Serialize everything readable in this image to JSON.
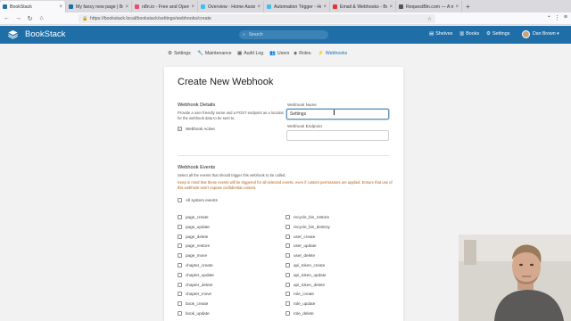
{
  "browser": {
    "tabs": [
      {
        "label": "BookStack",
        "active": true,
        "color": "#206ea7"
      },
      {
        "label": "My fancy new page | Bo",
        "active": false,
        "color": "#206ea7"
      },
      {
        "label": "n8n.io - Free and Open S",
        "active": false,
        "color": "#ea4b71"
      },
      {
        "label": "Overview - Home Assista",
        "active": false,
        "color": "#41bdf5"
      },
      {
        "label": "Automation Trigger - Hom",
        "active": false,
        "color": "#41bdf5"
      },
      {
        "label": "Email & Webhooks - Bots",
        "active": false,
        "color": "#e3342f"
      },
      {
        "label": "RequestBin.com — A mo",
        "active": false,
        "color": "#555555"
      }
    ],
    "new_tab": "+",
    "url": "https://bookstack.local/bookstack/settings/webhooks/create"
  },
  "header": {
    "app_name": "BookStack",
    "search_placeholder": "Search",
    "nav": [
      {
        "label": "Shelves",
        "icon": "shelves-icon"
      },
      {
        "label": "Books",
        "icon": "books-icon"
      },
      {
        "label": "Settings",
        "icon": "gear-icon"
      }
    ],
    "user_name": "Dan Brown ▾",
    "brand_color": "#206ea7"
  },
  "settings_nav": [
    {
      "label": "Settings",
      "icon": "gear-icon",
      "active": false
    },
    {
      "label": "Maintenance",
      "icon": "wrench-icon",
      "active": false
    },
    {
      "label": "Audit Log",
      "icon": "log-icon",
      "active": false
    },
    {
      "label": "Users",
      "icon": "users-icon",
      "active": false
    },
    {
      "label": "Roles",
      "icon": "roles-icon",
      "active": false
    },
    {
      "label": "Webhooks",
      "icon": "webhooks-icon",
      "active": true
    }
  ],
  "form": {
    "title": "Create New Webhook",
    "details_title": "Webhook Details",
    "details_desc_1": "Provide a user friendly name and a POST endpoint as a location",
    "details_desc_2": "for the webhook data to be sent to.",
    "active_label": "Webhook Active",
    "active_checked": true,
    "name_label": "Webhook Name",
    "name_value": "Settings",
    "endpoint_label": "Webhook Endpoint",
    "endpoint_value": "",
    "events_title": "Webhook Events",
    "events_desc": "Select all the events that should trigger this webhook to be called.",
    "events_warning_1": "Keep in mind that these events will be triggered for all selected events, even if custom permissions are applied. Ensure that use of",
    "events_warning_2": "this webhook won't expose confidential content.",
    "all_events_label": "All system events",
    "events_left": [
      "page_create",
      "page_update",
      "page_delete",
      "page_restore",
      "page_move",
      "chapter_create",
      "chapter_update",
      "chapter_delete",
      "chapter_move",
      "book_create",
      "book_update"
    ],
    "events_right": [
      "recycle_bin_restore",
      "recycle_bin_destroy",
      "user_create",
      "user_update",
      "user_delete",
      "api_token_create",
      "api_token_update",
      "api_token_delete",
      "role_create",
      "role_update",
      "role_delete"
    ]
  }
}
